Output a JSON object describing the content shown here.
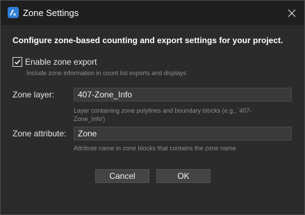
{
  "window": {
    "title": "Zone Settings"
  },
  "dialog": {
    "heading": "Configure zone-based counting and export settings for your project.",
    "enable_export": {
      "label": "Enable zone export",
      "checked": true,
      "hint": "Include zone information in count list exports and displays"
    },
    "zone_layer": {
      "label": "Zone layer:",
      "value": "407-Zone_Info",
      "hint_line1": "Layer containing zone polylines and boundary blocks (e.g., '407-",
      "hint_line2": "Zone_Info')"
    },
    "zone_attribute": {
      "label": "Zone attribute:",
      "value": "Zone",
      "hint": "Attribute name in zone blocks that contains the zone name"
    },
    "buttons": {
      "cancel": "Cancel",
      "ok": "OK"
    }
  },
  "icons": {
    "app": "app-logo-icon",
    "close": "close-icon",
    "checkmark": "checkmark-icon"
  },
  "colors": {
    "window_bg": "#2b2b2b",
    "titlebar_bg": "#1f1f1f",
    "input_bg": "#3a3a3a",
    "button_bg": "#444444",
    "accent": "#2f7fd8",
    "hint_text": "#8c8c8c"
  }
}
